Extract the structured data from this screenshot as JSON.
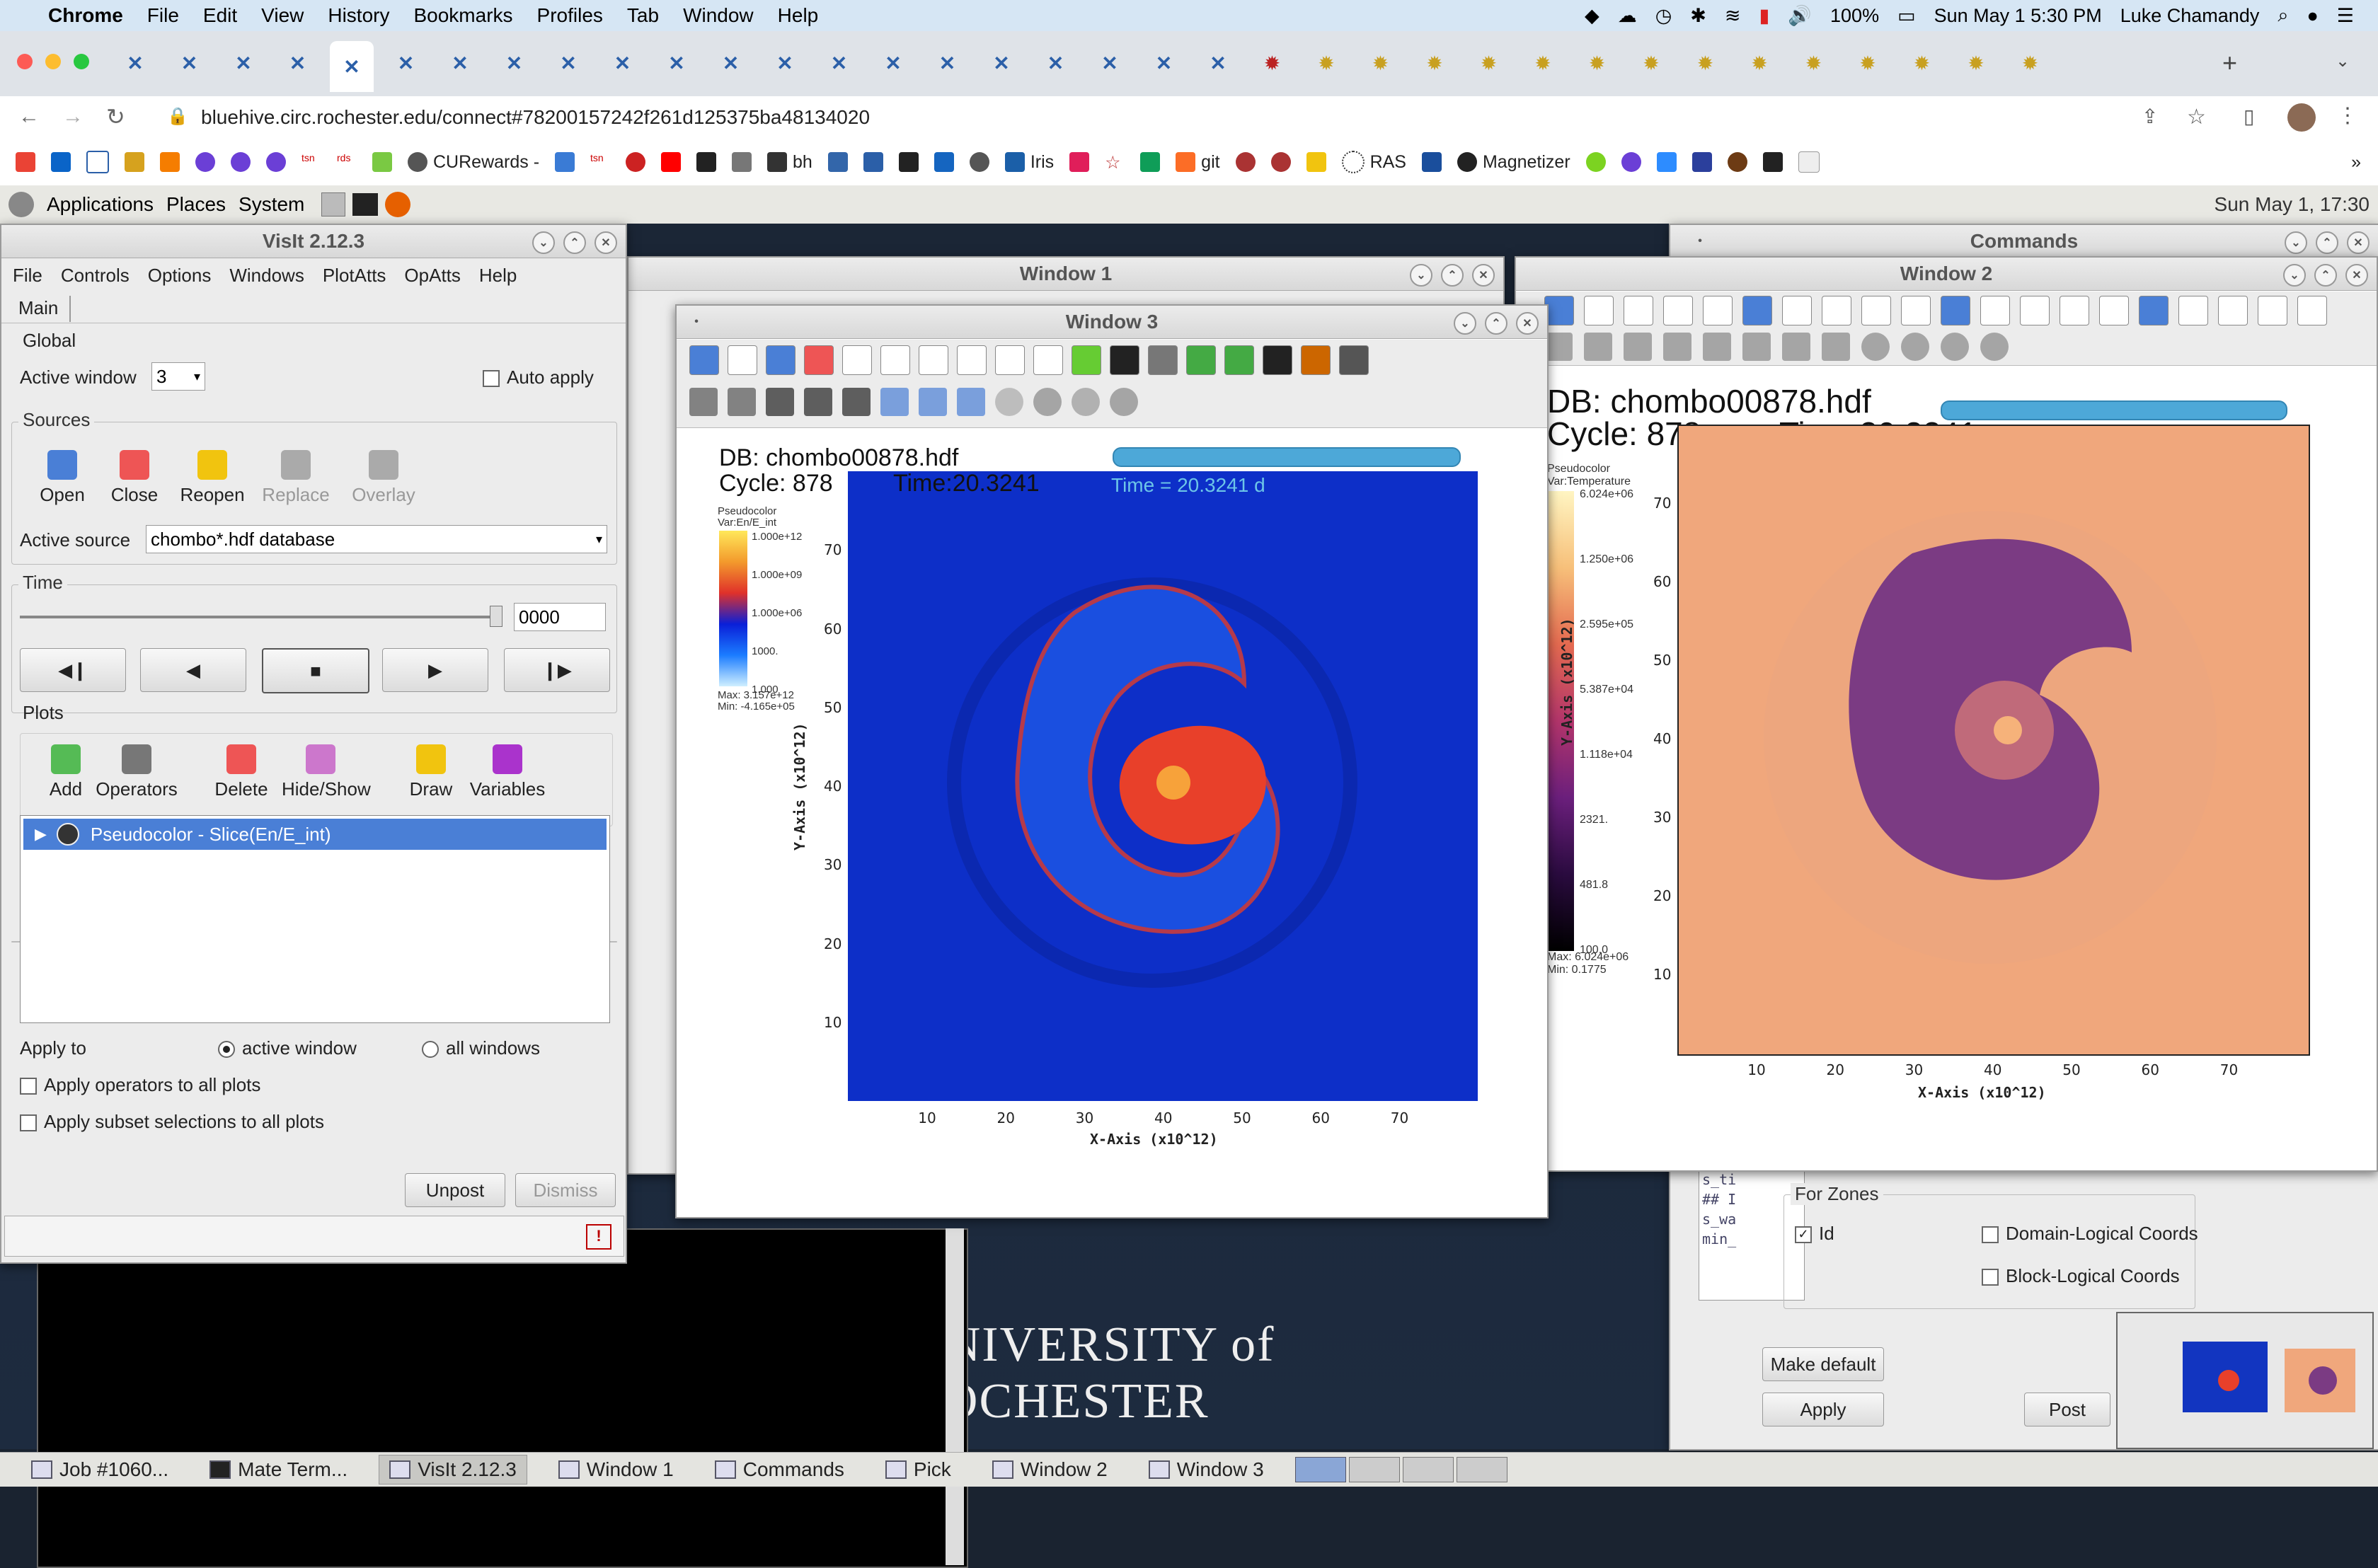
{
  "mac_menu": {
    "app": "Chrome",
    "items": [
      "File",
      "Edit",
      "View",
      "History",
      "Bookmarks",
      "Profiles",
      "Tab",
      "Window",
      "Help"
    ],
    "battery": "100%",
    "datetime": "Sun May 1  5:30 PM",
    "user": "Luke Chamandy"
  },
  "browser": {
    "url": "bluehive.circ.rochester.edu/connect#78200157242f261d125375ba48134020",
    "bookmarks": [
      "CURewards -",
      "bh",
      "Iris",
      "git",
      "RAS",
      "Magnetizer"
    ]
  },
  "gnome_panel": {
    "items": [
      "Applications",
      "Places",
      "System"
    ],
    "clock": "Sun May  1, 17:30"
  },
  "visit_main": {
    "title": "VisIt 2.12.3",
    "menu": [
      "File",
      "Controls",
      "Options",
      "Windows",
      "PlotAtts",
      "OpAtts",
      "Help"
    ],
    "tab": "Main",
    "global_label": "Global",
    "active_window_label": "Active window",
    "active_window_value": "3",
    "auto_apply": "Auto apply",
    "sources_label": "Sources",
    "source_buttons": [
      "Open",
      "Close",
      "Reopen",
      "Replace",
      "Overlay"
    ],
    "active_source_label": "Active source",
    "active_source_value": "chombo*.hdf database",
    "time_label": "Time",
    "time_value": "0000",
    "plots_label": "Plots",
    "plot_buttons": [
      "Add",
      "Operators",
      "Delete",
      "Hide/Show",
      "Draw",
      "Variables"
    ],
    "plot_item": "Pseudocolor - Slice(En/E_int)",
    "apply_to": "Apply to",
    "active_window_radio": "active window",
    "all_windows_radio": "all windows",
    "apply_operators": "Apply operators to all plots",
    "apply_subset": "Apply subset selections to all plots",
    "unpost": "Unpost",
    "dismiss": "Dismiss"
  },
  "window1": {
    "title": "Window 1"
  },
  "window3": {
    "title": "Window 3",
    "db": "DB: chombo00878.hdf",
    "cycle": "Cycle: 878",
    "time": "Time:20.3241",
    "time_annot": "Time = 20.3241 d",
    "legend_title": "Pseudocolor",
    "legend_var": "Var:En/E_int",
    "legend_ticks": [
      "1.000e+12",
      "1.000e+09",
      "1.000e+06",
      "1000.",
      "1.000"
    ],
    "legend_max": "Max: 3.157e+12",
    "legend_min": "Min: -4.165e+05",
    "xlabel": "X-Axis  (x10^12)",
    "ylabel": "Y-Axis  (x10^12)",
    "xticks": [
      "10",
      "20",
      "30",
      "40",
      "50",
      "60",
      "70"
    ],
    "yticks": [
      "70",
      "60",
      "50",
      "40",
      "30",
      "20",
      "10"
    ],
    "colors": {
      "background": "#0d2fc8",
      "core": "#e8402a"
    }
  },
  "window2": {
    "title": "Window 2",
    "db": "DB: chombo00878.hdf",
    "cycle": "Cycle: 878",
    "time": "Time:20.3241",
    "time_annot": "Time = 20.3241 d",
    "legend_title": "Pseudocolor",
    "legend_var": "Var:Temperature",
    "legend_ticks": [
      "6.024e+06",
      "1.250e+06",
      "2.595e+05",
      "5.387e+04",
      "1.118e+04",
      "2321.",
      "481.8",
      "100.0"
    ],
    "legend_max": "Max: 6.024e+06",
    "legend_min": "Min: 0.1775",
    "xlabel": "X-Axis  (x10^12)",
    "ylabel": "Y-Axis  (x10^12)",
    "xticks": [
      "10",
      "20",
      "30",
      "40",
      "50",
      "60",
      "70"
    ],
    "yticks": [
      "70",
      "60",
      "50",
      "40",
      "30",
      "20",
      "10"
    ],
    "colors": {
      "background": "#f0a77c",
      "core": "#7b3b83"
    }
  },
  "commands": {
    "title": "Commands",
    "for_zones": "For Zones",
    "id": "Id",
    "domain_logical": "Domain-Logical Coords",
    "block_logical": "Block-Logical Coords",
    "make_default": "Make default",
    "apply": "Apply",
    "post": "Post"
  },
  "desktop": {
    "logo_text": "UNIVERSITY of ROCHESTER"
  },
  "taskbar": [
    "Job #1060...",
    "Mate Term...",
    "VisIt 2.12.3",
    "Window 1",
    "Commands",
    "Pick",
    "Window 2",
    "Window 3"
  ]
}
